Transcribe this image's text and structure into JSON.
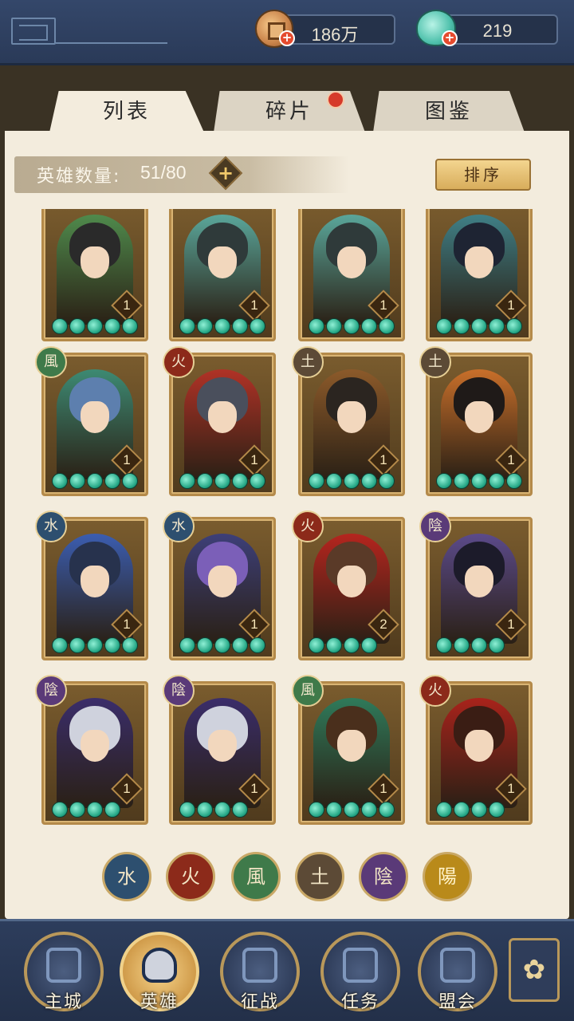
{
  "resources": {
    "coin": {
      "value": "186万",
      "icon": "copper-coin-icon"
    },
    "jade": {
      "value": "219",
      "icon": "jade-icon"
    }
  },
  "tabs": [
    {
      "label": "列表",
      "active": true
    },
    {
      "label": "碎片",
      "active": false,
      "notification": true
    },
    {
      "label": "图鉴",
      "active": false
    }
  ],
  "hero_count": {
    "label": "英雄数量:",
    "value": "51/80"
  },
  "sort_button": "排序",
  "heroes": [
    {
      "element": "",
      "level": "1",
      "stars": 5,
      "hair": "#2a2a2a",
      "robe": "#4f8a4c"
    },
    {
      "element": "",
      "level": "1",
      "stars": 5,
      "hair": "#2f3a3a",
      "robe": "#5aa69a"
    },
    {
      "element": "",
      "level": "1",
      "stars": 5,
      "hair": "#2f3a3a",
      "robe": "#5aa69a"
    },
    {
      "element": "",
      "level": "1",
      "stars": 5,
      "hair": "#1e2433",
      "robe": "#3f7f86"
    },
    {
      "element": "風",
      "level": "1",
      "stars": 5,
      "hair": "#5d7fae",
      "robe": "#3d8a73"
    },
    {
      "element": "火",
      "level": "1",
      "stars": 5,
      "hair": "#4a4f5c",
      "robe": "#b03226"
    },
    {
      "element": "土",
      "level": "1",
      "stars": 5,
      "hair": "#2b2520",
      "robe": "#8c5a2a"
    },
    {
      "element": "土",
      "level": "1",
      "stars": 5,
      "hair": "#1f1a18",
      "robe": "#c86f2a"
    },
    {
      "element": "水",
      "level": "1",
      "stars": 5,
      "hair": "#27324d",
      "robe": "#3b5db0"
    },
    {
      "element": "水",
      "level": "1",
      "stars": 5,
      "hair": "#7b5fb8",
      "robe": "#3d3f78"
    },
    {
      "element": "火",
      "level": "2",
      "stars": 4,
      "hair": "#5a3a28",
      "robe": "#b5251e"
    },
    {
      "element": "陰",
      "level": "1",
      "stars": 4,
      "hair": "#1c1b2a",
      "robe": "#5b4a8a"
    },
    {
      "element": "陰",
      "level": "1",
      "stars": 4,
      "hair": "#cfd2dd",
      "robe": "#3a2d6a"
    },
    {
      "element": "陰",
      "level": "1",
      "stars": 4,
      "hair": "#cfd2dd",
      "robe": "#3a2d6a"
    },
    {
      "element": "風",
      "level": "1",
      "stars": 5,
      "hair": "#4a2f1c",
      "robe": "#2f7a5a"
    },
    {
      "element": "火",
      "level": "1",
      "stars": 4,
      "hair": "#3a1d14",
      "robe": "#a8231b"
    }
  ],
  "element_badge_colors": {
    "風": "#3f7a4a",
    "火": "#8c2a1a",
    "土": "#5c4a36",
    "水": "#2d4f6f",
    "陰": "#5a3a78",
    "陽": "#b98a1a"
  },
  "element_filters": [
    {
      "glyph": "水",
      "color": "#2d4f6f"
    },
    {
      "glyph": "火",
      "color": "#8c2a1a"
    },
    {
      "glyph": "風",
      "color": "#3f7a4a"
    },
    {
      "glyph": "土",
      "color": "#5c4a36"
    },
    {
      "glyph": "陰",
      "color": "#5a3a78"
    },
    {
      "glyph": "陽",
      "color": "#b98a1a"
    }
  ],
  "nav": [
    {
      "label": "主城",
      "active": false
    },
    {
      "label": "英雄",
      "active": true
    },
    {
      "label": "征战",
      "active": false
    },
    {
      "label": "任务",
      "active": false
    },
    {
      "label": "盟会",
      "active": false
    }
  ],
  "menu_icon": "flower-menu-icon"
}
